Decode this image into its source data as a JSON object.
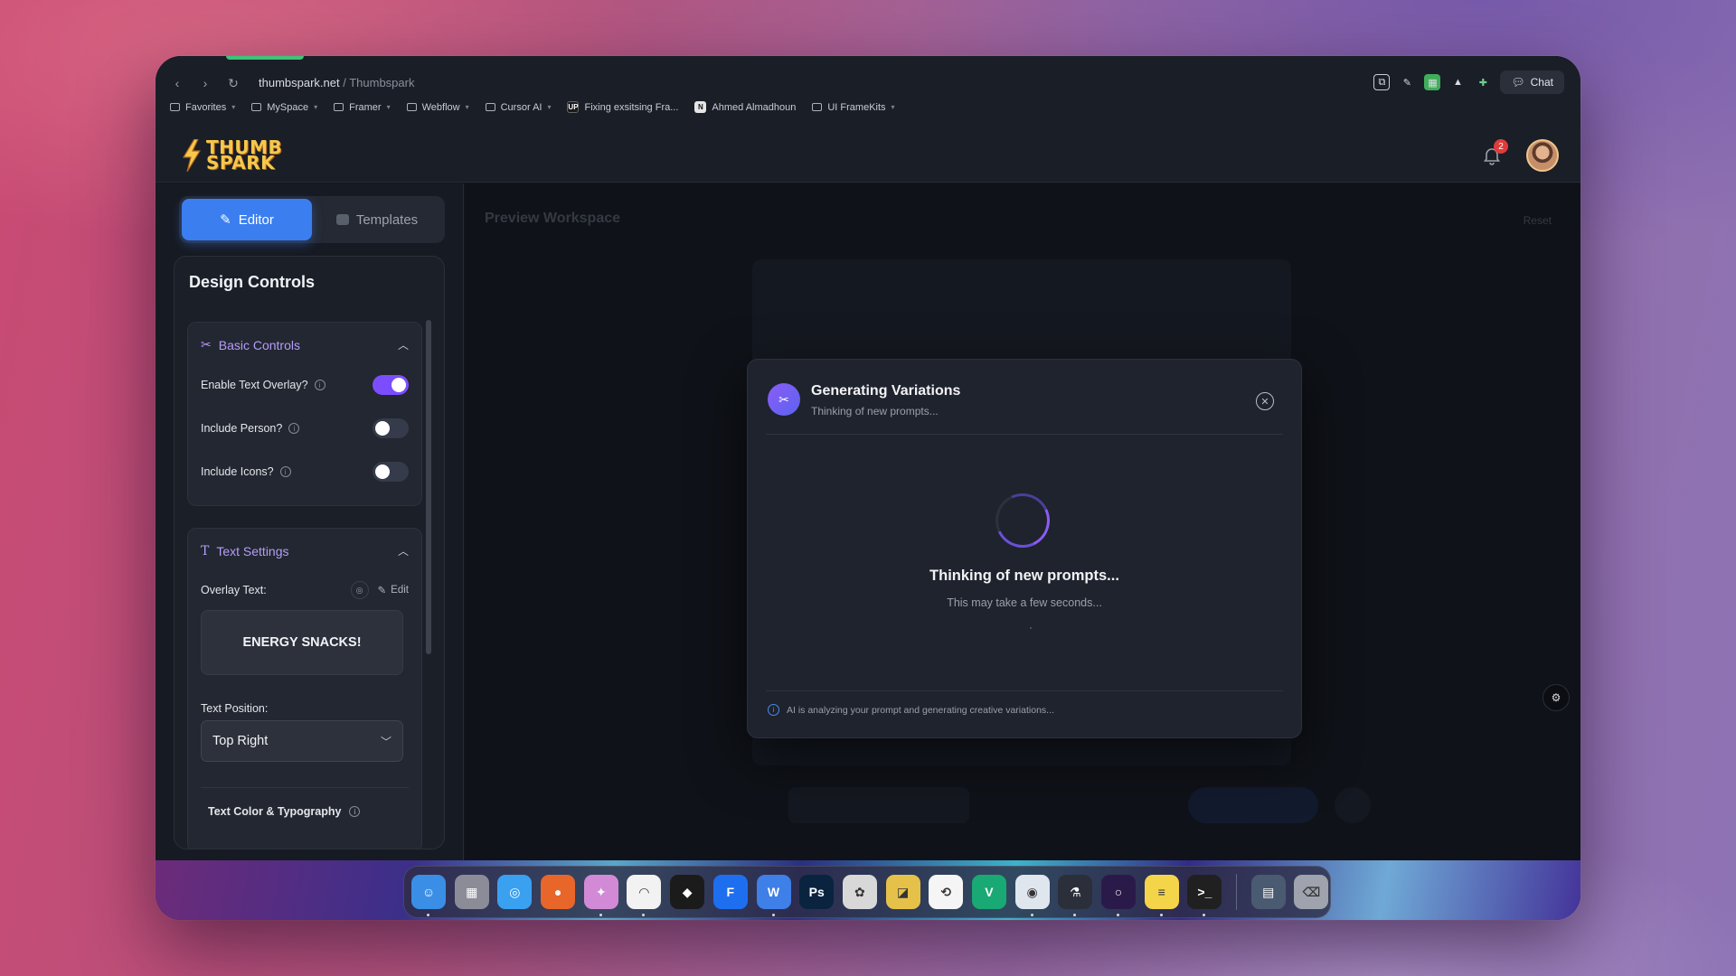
{
  "browser": {
    "url_host": "thumbspark.net",
    "url_path": "/ Thumbspark",
    "chat_label": "Chat",
    "bookmarks": [
      {
        "label": "Favorites",
        "kind": "folder"
      },
      {
        "label": "MySpace",
        "kind": "folder"
      },
      {
        "label": "Framer",
        "kind": "folder"
      },
      {
        "label": "Webflow",
        "kind": "folder"
      },
      {
        "label": "Cursor AI",
        "kind": "folder"
      },
      {
        "label": "Fixing exsitsing Fra...",
        "kind": "link",
        "badge": "UP"
      },
      {
        "label": "Ahmed Almadhoun",
        "kind": "link",
        "badge": "N"
      },
      {
        "label": "UI FrameKits",
        "kind": "folder"
      }
    ]
  },
  "header": {
    "logo_line1": "THUMB",
    "logo_line2": "SPARK",
    "notification_count": "2"
  },
  "sidebar": {
    "tabs": {
      "editor": "Editor",
      "templates": "Templates"
    },
    "panel_title": "Design Controls",
    "basic_controls": {
      "title": "Basic Controls",
      "enable_text_overlay": {
        "label": "Enable Text Overlay?",
        "on": true
      },
      "include_person": {
        "label": "Include Person?",
        "on": false
      },
      "include_icons": {
        "label": "Include Icons?",
        "on": false
      }
    },
    "text_settings": {
      "title": "Text Settings",
      "overlay_text_label": "Overlay Text:",
      "edit_label": "Edit",
      "overlay_text_value": "ENERGY SNACKS!",
      "text_position_label": "Text Position:",
      "text_position_value": "Top Right",
      "typography_label": "Text Color & Typography"
    }
  },
  "workspace": {
    "title": "Preview Workspace",
    "reset_label": "Reset"
  },
  "modal": {
    "title": "Generating Variations",
    "subtitle": "Thinking of new prompts...",
    "main_text": "Thinking of new prompts...",
    "secondary_text": "This may take a few seconds...",
    "footer_text": "AI is analyzing your prompt and generating creative variations..."
  },
  "dock": {
    "apps": [
      {
        "name": "finder-icon",
        "color": "#3a8ee6",
        "glyph": "☺"
      },
      {
        "name": "launchpad-icon",
        "color": "#8c8c99",
        "glyph": "▦"
      },
      {
        "name": "safari-icon",
        "color": "#3aa0f0",
        "glyph": "◎"
      },
      {
        "name": "firefox-icon",
        "color": "#e8662a",
        "glyph": "●"
      },
      {
        "name": "cleanmymac-icon",
        "color": "#d28ad6",
        "glyph": "✦"
      },
      {
        "name": "arc-icon",
        "color": "#f2f2f2",
        "glyph": "◠"
      },
      {
        "name": "cursor-icon",
        "color": "#1b1b1b",
        "glyph": "◆"
      },
      {
        "name": "framer-icon",
        "color": "#1e6ff0",
        "glyph": "F"
      },
      {
        "name": "webflow-icon",
        "color": "#3f7fe8",
        "glyph": "W"
      },
      {
        "name": "photoshop-icon",
        "color": "#0a2440",
        "glyph": "Ps"
      },
      {
        "name": "davinci-icon",
        "color": "#d8d8d8",
        "glyph": "✿"
      },
      {
        "name": "maps-icon",
        "color": "#e6c14a",
        "glyph": "◪"
      },
      {
        "name": "sync-icon",
        "color": "#f5f5f5",
        "glyph": "⟲"
      },
      {
        "name": "vectorize-icon",
        "color": "#19a974",
        "glyph": "V"
      },
      {
        "name": "preview-icon",
        "color": "#dfe6ee",
        "glyph": "◉"
      },
      {
        "name": "lab-icon",
        "color": "#2b2f3a",
        "glyph": "⚗"
      },
      {
        "name": "screen-recorder-icon",
        "color": "#2a1a4a",
        "glyph": "○"
      },
      {
        "name": "notes-icon",
        "color": "#f4d54a",
        "glyph": "≡"
      },
      {
        "name": "terminal-icon",
        "color": "#202020",
        "glyph": ">_"
      },
      {
        "name": "downloads-folder-icon",
        "color": "#4a5a70",
        "glyph": "▤"
      },
      {
        "name": "trash-icon",
        "color": "#9ea3ad",
        "glyph": "⌫"
      }
    ]
  }
}
